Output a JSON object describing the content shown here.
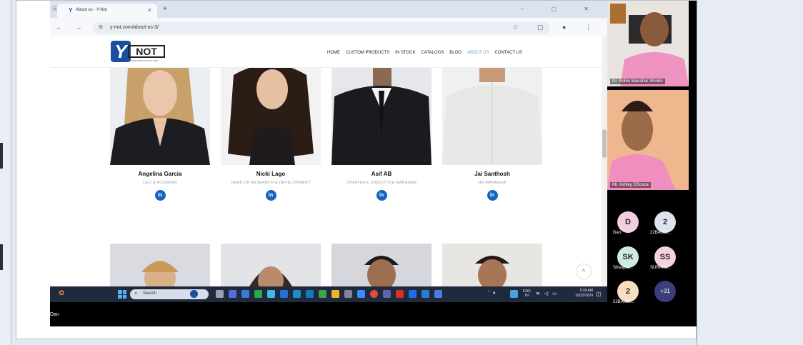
{
  "browser": {
    "tab_title": "About us - Y-Not",
    "tab_close": "×",
    "new_tab": "+",
    "url": "y-not.com/about-us-3/",
    "nav": "← → C"
  },
  "site": {
    "logo_y": "Y",
    "logo_not": "NOT",
    "logo_tagline": "CUSTOM PRODUCTS ON TIME",
    "menu": [
      "HOME",
      "CUSTOM PRODUCTS",
      "IN STOCK",
      "CATALOGS",
      "BLOG",
      "ABOUT US",
      "CONTACT US"
    ],
    "team": [
      {
        "name": "Angelina Garcia",
        "role": "CEO & FOUNDER",
        "linkedin": "in"
      },
      {
        "name": "Nicki Lago",
        "role": "HEAD OF RESEARCH & DEVELOPMENT",
        "linkedin": "in"
      },
      {
        "name": "Asif AB",
        "role": "STRATEGIC EXECUTIVE MANAGER",
        "linkedin": "in"
      },
      {
        "name": "Jai Santhosh",
        "role": "HR MANAGER",
        "linkedin": "in"
      }
    ],
    "scroll_up": "^"
  },
  "taskbar": {
    "search_placeholder": "Search",
    "lang_top": "ENG",
    "lang_bottom": "IN",
    "time": "5:39 AM",
    "date": "10/23/2024"
  },
  "meeting": {
    "presenter_name": "Dan",
    "participants_video": [
      {
        "name": "Dr. Robin Manohar Shinde"
      },
      {
        "name": "Mr. Ashley DSouza"
      }
    ],
    "participants_avatars": [
      {
        "initials": "D",
        "label": "Dan",
        "color": "#f0cfe0"
      },
      {
        "initials": "2",
        "label": "22BA058...",
        "color": "#dfe3f0"
      },
      {
        "initials": "SK",
        "label": "Shivajira...",
        "color": "#cfeadf"
      },
      {
        "initials": "SS",
        "label": "SURAKS...",
        "color": "#f5d1dc"
      },
      {
        "initials": "2",
        "label": "22BA038...",
        "color": "#f4dfc0"
      }
    ],
    "more_count": "+31"
  }
}
